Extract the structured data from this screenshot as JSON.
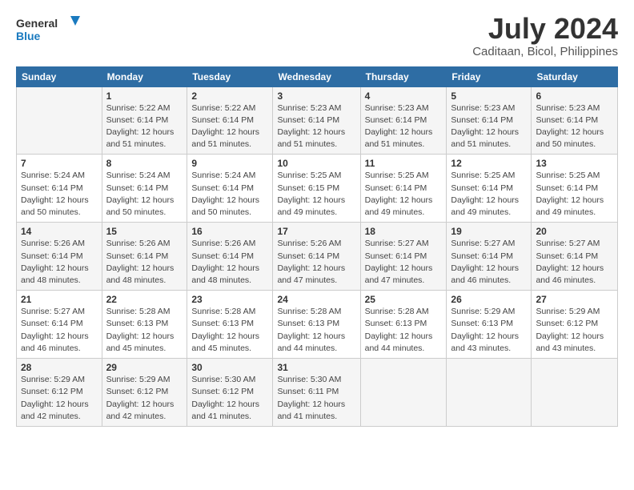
{
  "logo": {
    "line1": "General",
    "line2": "Blue"
  },
  "title": "July 2024",
  "subtitle": "Caditaan, Bicol, Philippines",
  "days_header": [
    "Sunday",
    "Monday",
    "Tuesday",
    "Wednesday",
    "Thursday",
    "Friday",
    "Saturday"
  ],
  "weeks": [
    [
      {
        "num": "",
        "info": ""
      },
      {
        "num": "1",
        "info": "Sunrise: 5:22 AM\nSunset: 6:14 PM\nDaylight: 12 hours\nand 51 minutes."
      },
      {
        "num": "2",
        "info": "Sunrise: 5:22 AM\nSunset: 6:14 PM\nDaylight: 12 hours\nand 51 minutes."
      },
      {
        "num": "3",
        "info": "Sunrise: 5:23 AM\nSunset: 6:14 PM\nDaylight: 12 hours\nand 51 minutes."
      },
      {
        "num": "4",
        "info": "Sunrise: 5:23 AM\nSunset: 6:14 PM\nDaylight: 12 hours\nand 51 minutes."
      },
      {
        "num": "5",
        "info": "Sunrise: 5:23 AM\nSunset: 6:14 PM\nDaylight: 12 hours\nand 51 minutes."
      },
      {
        "num": "6",
        "info": "Sunrise: 5:23 AM\nSunset: 6:14 PM\nDaylight: 12 hours\nand 50 minutes."
      }
    ],
    [
      {
        "num": "7",
        "info": "Sunrise: 5:24 AM\nSunset: 6:14 PM\nDaylight: 12 hours\nand 50 minutes."
      },
      {
        "num": "8",
        "info": "Sunrise: 5:24 AM\nSunset: 6:14 PM\nDaylight: 12 hours\nand 50 minutes."
      },
      {
        "num": "9",
        "info": "Sunrise: 5:24 AM\nSunset: 6:14 PM\nDaylight: 12 hours\nand 50 minutes."
      },
      {
        "num": "10",
        "info": "Sunrise: 5:25 AM\nSunset: 6:15 PM\nDaylight: 12 hours\nand 49 minutes."
      },
      {
        "num": "11",
        "info": "Sunrise: 5:25 AM\nSunset: 6:14 PM\nDaylight: 12 hours\nand 49 minutes."
      },
      {
        "num": "12",
        "info": "Sunrise: 5:25 AM\nSunset: 6:14 PM\nDaylight: 12 hours\nand 49 minutes."
      },
      {
        "num": "13",
        "info": "Sunrise: 5:25 AM\nSunset: 6:14 PM\nDaylight: 12 hours\nand 49 minutes."
      }
    ],
    [
      {
        "num": "14",
        "info": "Sunrise: 5:26 AM\nSunset: 6:14 PM\nDaylight: 12 hours\nand 48 minutes."
      },
      {
        "num": "15",
        "info": "Sunrise: 5:26 AM\nSunset: 6:14 PM\nDaylight: 12 hours\nand 48 minutes."
      },
      {
        "num": "16",
        "info": "Sunrise: 5:26 AM\nSunset: 6:14 PM\nDaylight: 12 hours\nand 48 minutes."
      },
      {
        "num": "17",
        "info": "Sunrise: 5:26 AM\nSunset: 6:14 PM\nDaylight: 12 hours\nand 47 minutes."
      },
      {
        "num": "18",
        "info": "Sunrise: 5:27 AM\nSunset: 6:14 PM\nDaylight: 12 hours\nand 47 minutes."
      },
      {
        "num": "19",
        "info": "Sunrise: 5:27 AM\nSunset: 6:14 PM\nDaylight: 12 hours\nand 46 minutes."
      },
      {
        "num": "20",
        "info": "Sunrise: 5:27 AM\nSunset: 6:14 PM\nDaylight: 12 hours\nand 46 minutes."
      }
    ],
    [
      {
        "num": "21",
        "info": "Sunrise: 5:27 AM\nSunset: 6:14 PM\nDaylight: 12 hours\nand 46 minutes."
      },
      {
        "num": "22",
        "info": "Sunrise: 5:28 AM\nSunset: 6:13 PM\nDaylight: 12 hours\nand 45 minutes."
      },
      {
        "num": "23",
        "info": "Sunrise: 5:28 AM\nSunset: 6:13 PM\nDaylight: 12 hours\nand 45 minutes."
      },
      {
        "num": "24",
        "info": "Sunrise: 5:28 AM\nSunset: 6:13 PM\nDaylight: 12 hours\nand 44 minutes."
      },
      {
        "num": "25",
        "info": "Sunrise: 5:28 AM\nSunset: 6:13 PM\nDaylight: 12 hours\nand 44 minutes."
      },
      {
        "num": "26",
        "info": "Sunrise: 5:29 AM\nSunset: 6:13 PM\nDaylight: 12 hours\nand 43 minutes."
      },
      {
        "num": "27",
        "info": "Sunrise: 5:29 AM\nSunset: 6:12 PM\nDaylight: 12 hours\nand 43 minutes."
      }
    ],
    [
      {
        "num": "28",
        "info": "Sunrise: 5:29 AM\nSunset: 6:12 PM\nDaylight: 12 hours\nand 42 minutes."
      },
      {
        "num": "29",
        "info": "Sunrise: 5:29 AM\nSunset: 6:12 PM\nDaylight: 12 hours\nand 42 minutes."
      },
      {
        "num": "30",
        "info": "Sunrise: 5:30 AM\nSunset: 6:12 PM\nDaylight: 12 hours\nand 41 minutes."
      },
      {
        "num": "31",
        "info": "Sunrise: 5:30 AM\nSunset: 6:11 PM\nDaylight: 12 hours\nand 41 minutes."
      },
      {
        "num": "",
        "info": ""
      },
      {
        "num": "",
        "info": ""
      },
      {
        "num": "",
        "info": ""
      }
    ]
  ]
}
